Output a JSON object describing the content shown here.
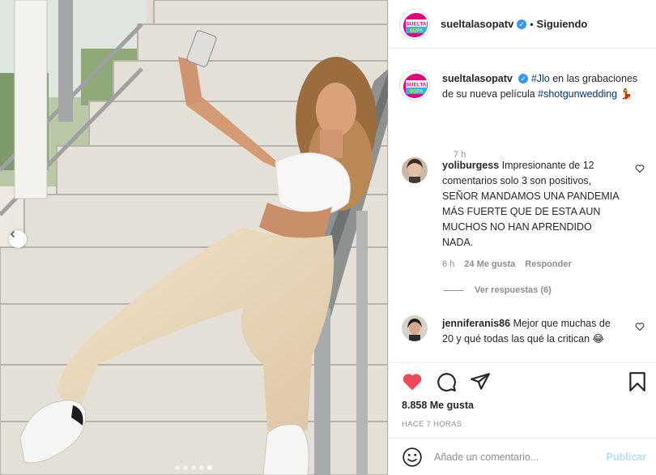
{
  "colors": {
    "accent_blue": "#3897f0",
    "link_blue": "#00376b",
    "liked_red": "#ed4956",
    "muted_text": "#8e8e8e",
    "logo_pink": "#e4007c",
    "logo_cyan": "#29b6e8",
    "logo_yellow": "#ffe600"
  },
  "post": {
    "image_alt": "Foto",
    "carousel": {
      "total": 5,
      "active": 5
    }
  },
  "header": {
    "username": "sueltalasopatv",
    "separator": "•",
    "follow_status": "Siguiendo",
    "verified_icon": "verified-badge-icon",
    "logo_text_top": "SUELTA",
    "logo_text_bottom": "SOPA"
  },
  "caption": {
    "username": "sueltalasopatv",
    "hashtag1": "#Jlo",
    "text": " en las grabaciones de su nueva película ",
    "hashtag2": "#shotgunwedding",
    "emoji": "💃",
    "time": "7 h"
  },
  "comments": [
    {
      "username": "yoliburgess",
      "text": "Impresionante de 12 comentarios solo 3 son positivos, SEÑOR MANDAMOS UNA PANDEMIA MÁS FUERTE QUE DE ESTA AUN MUCHOS NO HAN APRENDIDO NADA.",
      "time": "6 h",
      "likes": "24 Me gusta",
      "reply": "Responder",
      "view_replies": "Ver respuestas (6)"
    },
    {
      "username": "jenniferanis86",
      "text": "Mejor que muchas de 20 y qué todas las qué la critican",
      "emoji": "😂"
    }
  ],
  "actions": {
    "likes": "8.858 Me gusta",
    "timestamp": "HACE 7 HORAS",
    "icons": [
      "heart-filled-icon",
      "comment-icon",
      "share-icon",
      "bookmark-icon"
    ]
  },
  "add_comment": {
    "placeholder": "Añade un comentario...",
    "publish": "Publicar"
  }
}
